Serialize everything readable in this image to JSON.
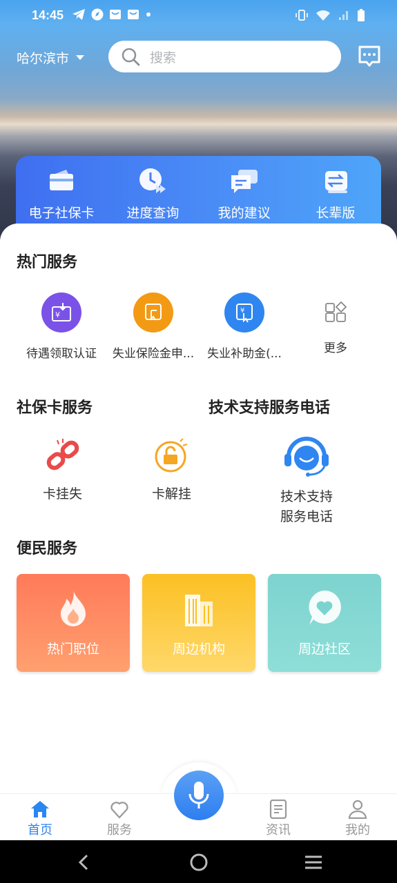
{
  "status_bar": {
    "time": "14:45"
  },
  "header": {
    "city": "哈尔滨市",
    "search_placeholder": "搜索"
  },
  "quick_actions": [
    {
      "label": "电子社保卡",
      "icon": "social-security-card-icon"
    },
    {
      "label": "进度查询",
      "icon": "progress-clock-icon"
    },
    {
      "label": "我的建议",
      "icon": "suggestion-chat-icon"
    },
    {
      "label": "长辈版",
      "icon": "switch-arrows-icon"
    }
  ],
  "hot_services": {
    "title": "热门服务",
    "items": [
      {
        "label": "待遇领取认证",
        "icon": "benefit-certification-icon",
        "color": "#7b52e8"
      },
      {
        "label": "失业保险金申...",
        "icon": "unemployment-insurance-icon",
        "color": "#f39a14"
      },
      {
        "label": "失业补助金(...",
        "icon": "unemployment-subsidy-icon",
        "color": "#2f86f0"
      },
      {
        "label": "更多",
        "icon": "more-grid-icon"
      }
    ]
  },
  "card_services": {
    "title": "社保卡服务",
    "items": [
      {
        "label": "卡挂失",
        "icon": "broken-link-icon",
        "color": "#e94a4a"
      },
      {
        "label": "卡解挂",
        "icon": "unlock-icon",
        "color": "#f5a623"
      }
    ]
  },
  "tech_support": {
    "title": "技术支持服务电话",
    "item": {
      "label_line1": "技术支持",
      "label_line2": "服务电话",
      "icon": "headset-support-icon",
      "color": "#2f86f0"
    }
  },
  "convenience": {
    "title": "便民服务",
    "tiles": [
      {
        "label": "热门职位",
        "icon": "flame-icon",
        "color_top": "#ff7a5a",
        "color_bottom": "#ffa06f"
      },
      {
        "label": "周边机构",
        "icon": "buildings-icon",
        "color_top": "#fbc023",
        "color_bottom": "#ffd86a"
      },
      {
        "label": "周边社区",
        "icon": "heart-bubble-icon",
        "color_top": "#7dd3cf",
        "color_bottom": "#8fded8"
      }
    ]
  },
  "bottom_nav": [
    {
      "label": "首页",
      "icon": "home-icon",
      "active": true
    },
    {
      "label": "服务",
      "icon": "heart-outline-icon",
      "active": false
    },
    {
      "label": "资讯",
      "icon": "document-icon",
      "active": false
    },
    {
      "label": "我的",
      "icon": "person-icon",
      "active": false
    }
  ],
  "accent_color": "#2a86f0"
}
